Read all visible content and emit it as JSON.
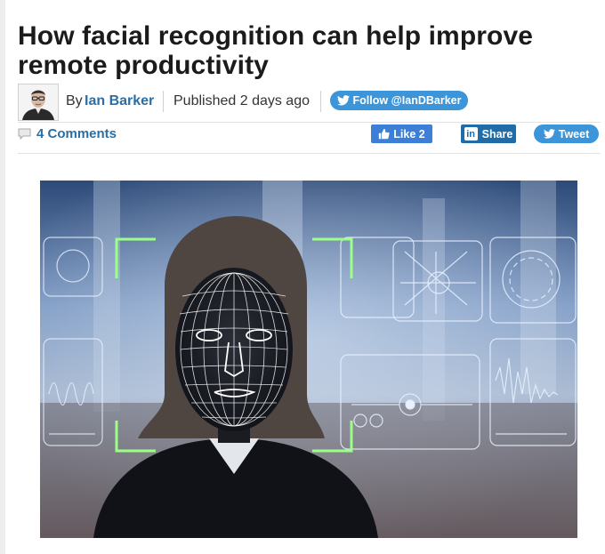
{
  "article": {
    "title": "How facial recognition can help improve remote productivity",
    "byline": {
      "by_label": "By",
      "author": "Ian Barker",
      "published": "Published 2 days ago"
    },
    "follow_button": {
      "label": "Follow @IanDBarker",
      "icon": "twitter-bird-icon"
    },
    "comments": {
      "label": "4 Comments",
      "icon": "speech-bubble-icon"
    },
    "like_button": {
      "label": "Like 2",
      "icon": "thumbs-up-icon"
    },
    "share_button": {
      "label": "Share",
      "icon_text": "in"
    },
    "tweet_button": {
      "label": "Tweet",
      "icon": "twitter-bird-icon"
    },
    "hero_image": {
      "subject": "woman with facial recognition mesh overlay and holographic UI panels"
    }
  },
  "colors": {
    "link": "#2c6ea3",
    "twitter": "#3b95d8",
    "facebook": "#3b7fd6",
    "linkedin": "#1f6ca9",
    "title_text": "#1b1b1b"
  }
}
